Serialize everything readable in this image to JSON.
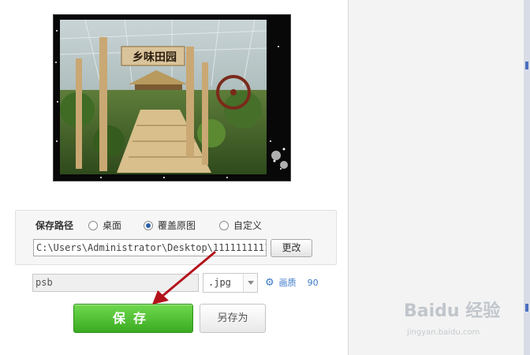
{
  "save_path": {
    "label": "保存路径",
    "options": [
      {
        "label": "桌面",
        "selected": false
      },
      {
        "label": "覆盖原图",
        "selected": true
      },
      {
        "label": "自定义",
        "selected": false
      }
    ],
    "path_value": "C:\\Users\\Administrator\\Desktop\\1111111111",
    "change_label": "更改"
  },
  "file": {
    "name_value": "psb",
    "format_value": ".jpg",
    "quality_label": "画质",
    "quality_value": "90"
  },
  "buttons": {
    "save_label": "保存",
    "save_as_label": "另存为"
  },
  "photo": {
    "sign_text": "乡味田园"
  },
  "watermark": {
    "brand": "Baidu 经验",
    "url": "jingyan.baidu.com"
  },
  "colors": {
    "save_green": "#3aab21",
    "link_blue": "#3a79c8",
    "arrow_red": "#b3121b"
  }
}
